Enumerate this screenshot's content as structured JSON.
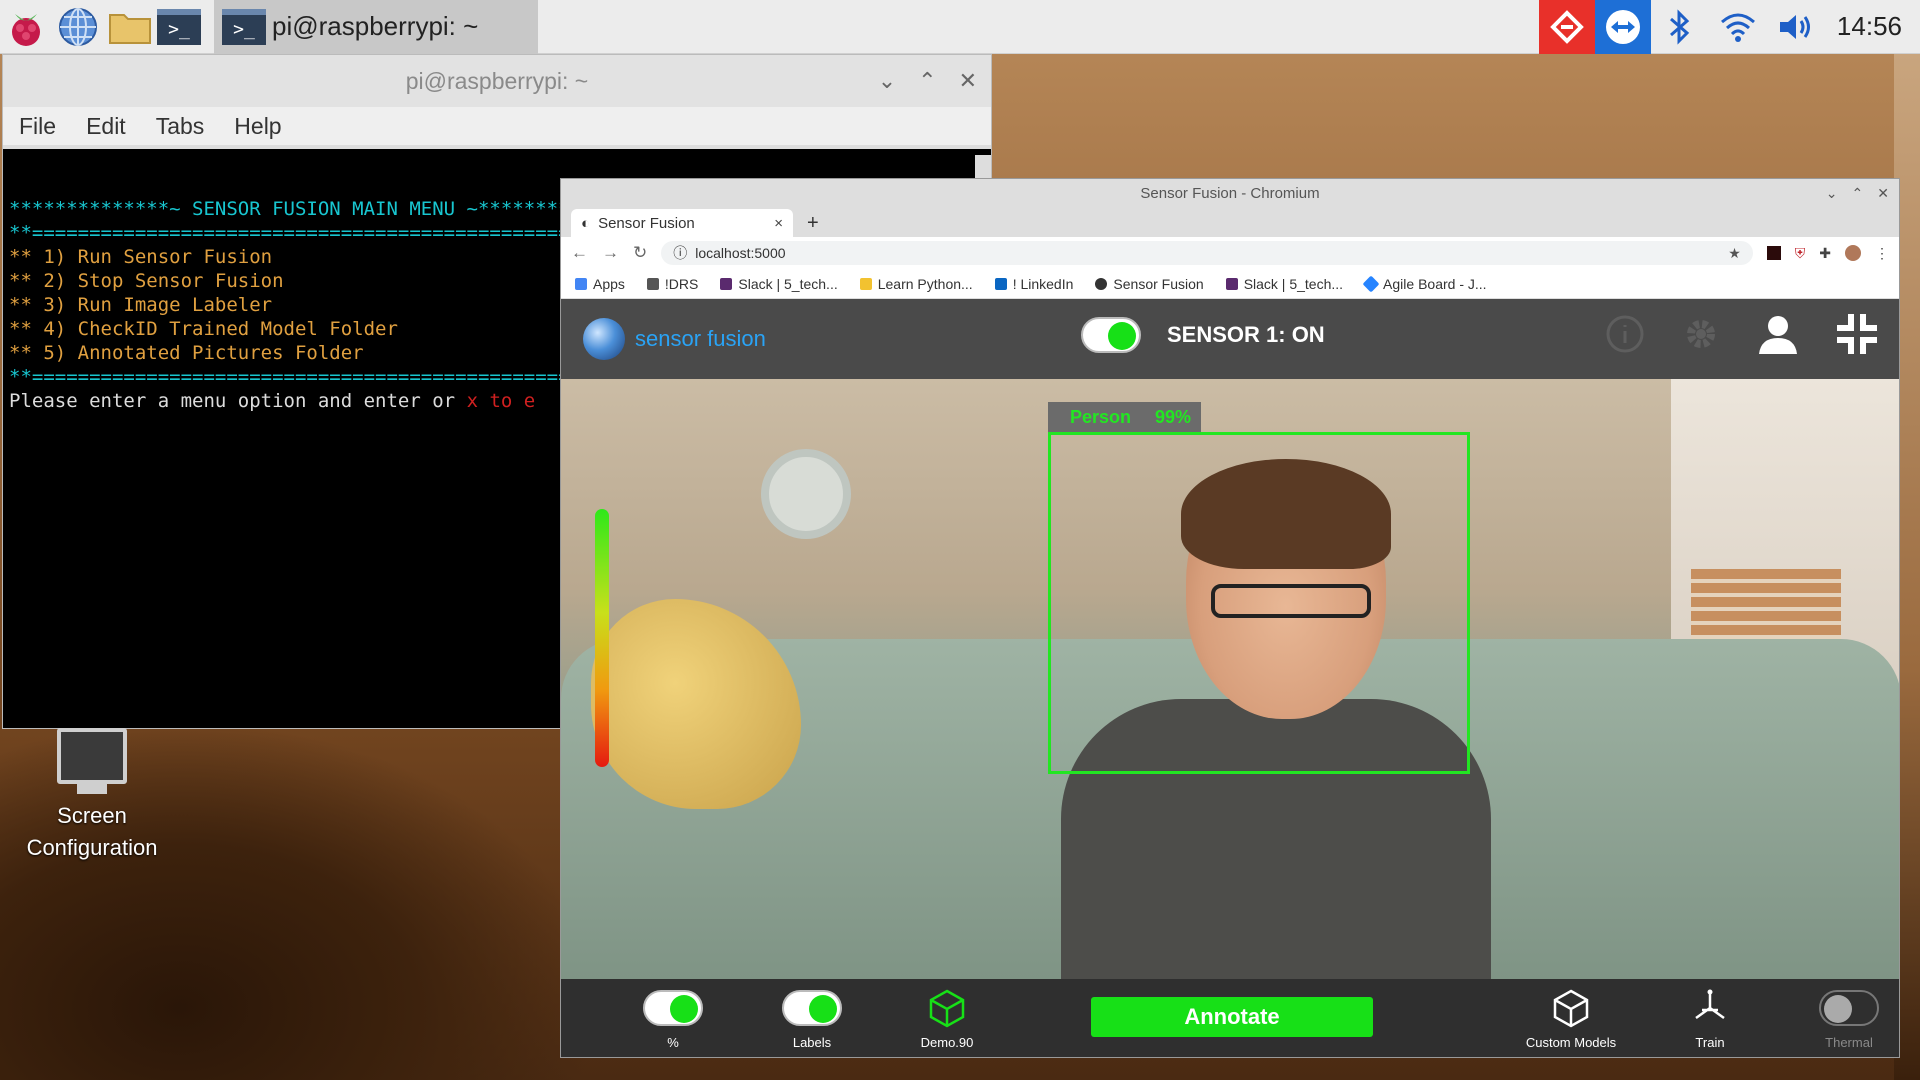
{
  "taskbar": {
    "task_label": "pi@raspberrypi: ~",
    "terminal_glyph": ">_",
    "clock": "14:56",
    "icons": [
      "raspberry-menu-icon",
      "web-browser-icon",
      "file-manager-icon",
      "terminal-icon",
      "remote-desktop-icon",
      "teamviewer-icon",
      "bluetooth-icon",
      "wifi-icon",
      "volume-icon"
    ],
    "colors": {
      "remote_red": "#e8302a",
      "teamviewer_blue": "#1e6fd6"
    }
  },
  "terminal": {
    "title": "pi@raspberrypi: ~",
    "menu": [
      "File",
      "Edit",
      "Tabs",
      "Help"
    ],
    "lines": [
      {
        "text": "**************~ SENSOR FUSION MAIN MENU ~**********",
        "color": "cyan"
      },
      {
        "text": "**==================================================",
        "color": "cyan"
      },
      {
        "text": "** 1) Run Sensor Fusion",
        "color": "orange"
      },
      {
        "text": "** 2) Stop Sensor Fusion",
        "color": "orange"
      },
      {
        "text": "** 3) Run Image Labeler",
        "color": "orange"
      },
      {
        "text": "** 4) CheckID Trained Model Folder",
        "color": "orange"
      },
      {
        "text": "** 5) Annotated Pictures Folder",
        "color": "orange"
      },
      {
        "text": "**==================================================",
        "color": "cyan"
      }
    ],
    "prompt_text": "Please enter a menu option and enter or ",
    "prompt_exit": "x to e"
  },
  "desktop_icon": {
    "label": "Screen Configuration"
  },
  "browser": {
    "window_title": "Sensor Fusion - Chromium",
    "tab_title": "Sensor Fusion",
    "tab_close": "×",
    "new_tab": "+",
    "url": "localhost:5000",
    "bookmarks": [
      {
        "label": "Apps",
        "color": "#4285f4"
      },
      {
        "label": "!DRS",
        "color": "#555555"
      },
      {
        "label": "Slack | 5_tech...",
        "color": "#5a2a6e"
      },
      {
        "label": "Learn Python...",
        "color": "#f2c230"
      },
      {
        "label": "! LinkedIn",
        "color": "#0a66c2"
      },
      {
        "label": "Sensor Fusion",
        "color": "#333333"
      },
      {
        "label": "Slack | 5_tech...",
        "color": "#5a2a6e"
      },
      {
        "label": "Agile Board - J...",
        "color": "#2684ff"
      }
    ]
  },
  "app": {
    "logo_text": "sensor fusion",
    "sensor_label": "SENSOR 1:  ON",
    "sensor_on": true,
    "accent": "#17e017",
    "detection": {
      "label": "Person",
      "confidence": "99%"
    },
    "toolbar": {
      "percent_label": "%",
      "labels_label": "Labels",
      "demo_label": "Demo.90",
      "annotate_label": "Annotate",
      "custom_models_label": "Custom Models",
      "train_label": "Train",
      "thermal_label": "Thermal"
    }
  }
}
